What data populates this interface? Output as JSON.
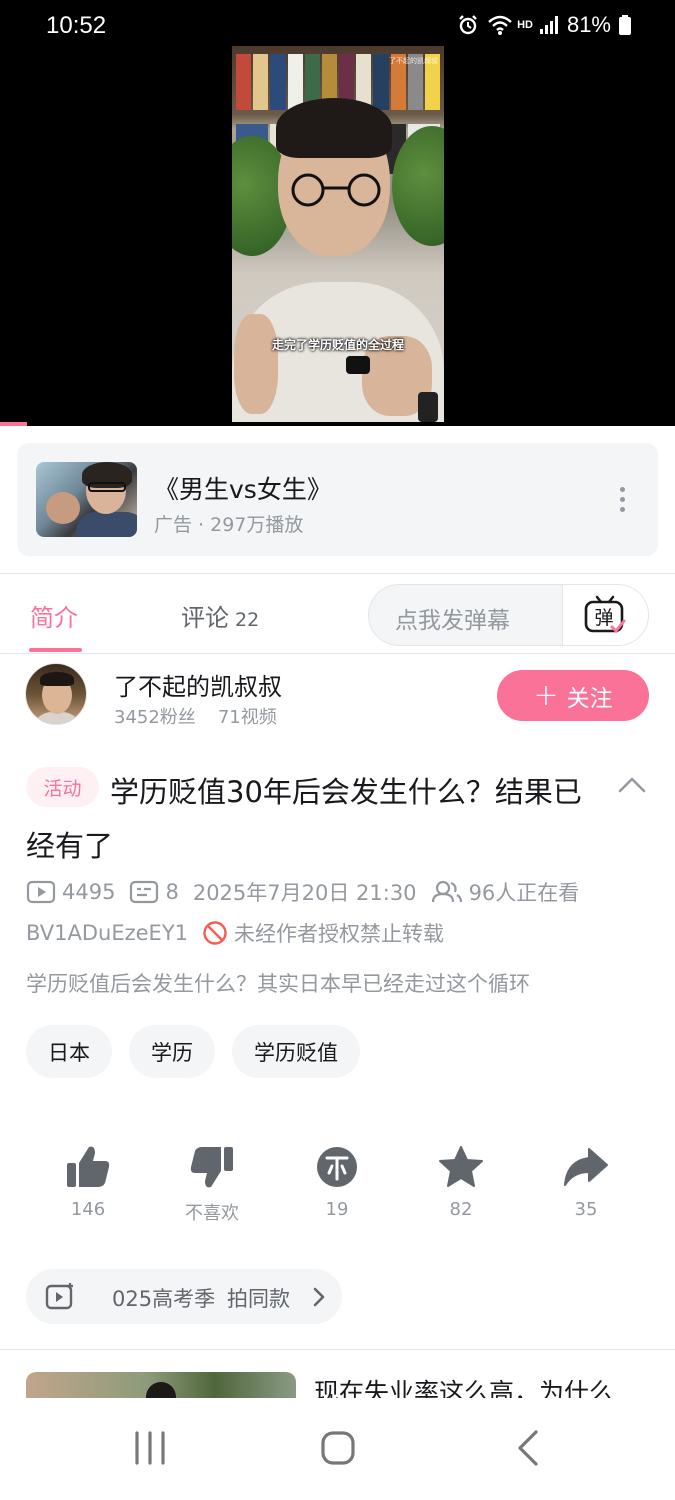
{
  "status_bar": {
    "time": "10:52",
    "hd": "HD",
    "battery": "81%"
  },
  "video": {
    "subtitle": "走完了学历贬值的全过程",
    "watermark": "了不起的凯叔叔",
    "progress": 0.04
  },
  "ad": {
    "title": "《男生vs女生》",
    "subtitle": "广告 · 297万播放"
  },
  "tabs": {
    "intro": "简介",
    "comments": "评论",
    "comment_count": "22",
    "danmaku_placeholder": "点我发弹幕",
    "danmaku_icon_char": "弹"
  },
  "uploader": {
    "name": "了不起的凯叔叔",
    "fans": "3452粉丝",
    "videos": "71视频",
    "follow_label": "关注"
  },
  "video_info": {
    "badge": "活动",
    "title": "学历贬值30年后会发生什么？结果已经有了",
    "plays": "4495",
    "danmaku_count": "8",
    "date": "2025年7月20日 21:30",
    "watching": "96人正在看",
    "bvid": "BV1ADuEzeEY1",
    "copyright": "未经作者授权禁止转载",
    "description": "学历贬值后会发生什么？其实日本早已经走过这个循环",
    "tags": [
      "日本",
      "学历",
      "学历贬值"
    ]
  },
  "actions": {
    "like": "146",
    "dislike": "不喜欢",
    "coin": "19",
    "favorite": "82",
    "share": "35"
  },
  "same_style": {
    "topic": "025高考季",
    "action": "拍同款"
  },
  "recommendation": {
    "title": "现在失业率这么高，为什么"
  },
  "colors": {
    "accent": "#fb7299",
    "text_primary": "#18191c",
    "text_secondary": "#9499a0",
    "chip_bg": "#f4f5f7",
    "icon_dark": "#61666d",
    "copyright_red": "#f85a54"
  }
}
